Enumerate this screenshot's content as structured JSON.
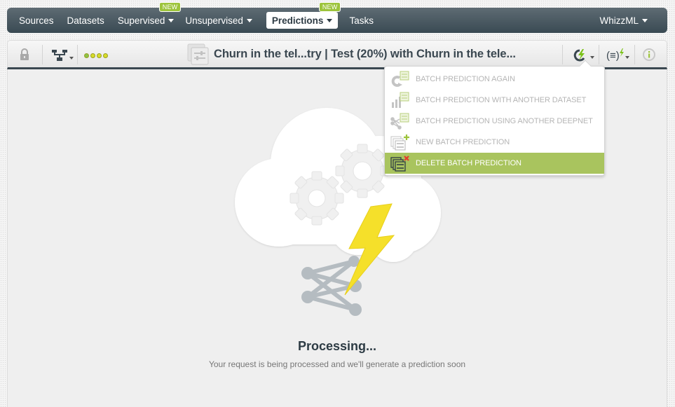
{
  "nav": {
    "items": [
      {
        "label": "Sources",
        "caret": false,
        "badge": null,
        "active": false
      },
      {
        "label": "Datasets",
        "caret": false,
        "badge": null,
        "active": false
      },
      {
        "label": "Supervised",
        "caret": true,
        "badge": "NEW",
        "active": false
      },
      {
        "label": "Unsupervised",
        "caret": true,
        "badge": null,
        "active": false
      },
      {
        "label": "Predictions",
        "caret": true,
        "badge": "NEW",
        "active": true
      },
      {
        "label": "Tasks",
        "caret": false,
        "badge": null,
        "active": false
      }
    ],
    "right_item": {
      "label": "WhizzML",
      "caret": true
    }
  },
  "toolbar": {
    "title": "Churn in the tel...try | Test (20%) with Churn in the tele...",
    "progress_dots": [
      {
        "state": "done",
        "color": "#8bc34a"
      },
      {
        "state": "pending",
        "color": "#d8dc2a"
      },
      {
        "state": "pending",
        "color": "#d8dc2a"
      },
      {
        "state": "pending",
        "color": "#d8dc2a"
      }
    ],
    "icons": [
      "lock-icon",
      "model-tree-icon",
      "batch-prediction-icon",
      "reprocess-actions-icon",
      "formula-actions-icon",
      "info-icon"
    ]
  },
  "menu": {
    "items": [
      {
        "label": "BATCH PREDICTION AGAIN",
        "icon": "rerun-batch-icon",
        "highlighted": false
      },
      {
        "label": "BATCH PREDICTION WITH ANOTHER DATASET",
        "icon": "dataset-batch-icon",
        "highlighted": false
      },
      {
        "label": "BATCH PREDICTION USING ANOTHER DEEPNET",
        "icon": "deepnet-batch-icon",
        "highlighted": false
      },
      {
        "label": "NEW BATCH PREDICTION",
        "icon": "new-batch-icon",
        "highlighted": false
      },
      {
        "label": "DELETE BATCH PREDICTION",
        "icon": "delete-batch-icon",
        "highlighted": true
      }
    ]
  },
  "main": {
    "status_title": "Processing...",
    "status_message": "Your request is being processed and we'll generate a prediction soon"
  },
  "colors": {
    "nav_top": "#5e6b73",
    "nav_bottom": "#3a4a53",
    "accent_green": "#9dc43c",
    "menu_highlight": "#a9c45e",
    "bolt_yellow": "#f5e02a",
    "text_dark": "#2d3b44"
  }
}
